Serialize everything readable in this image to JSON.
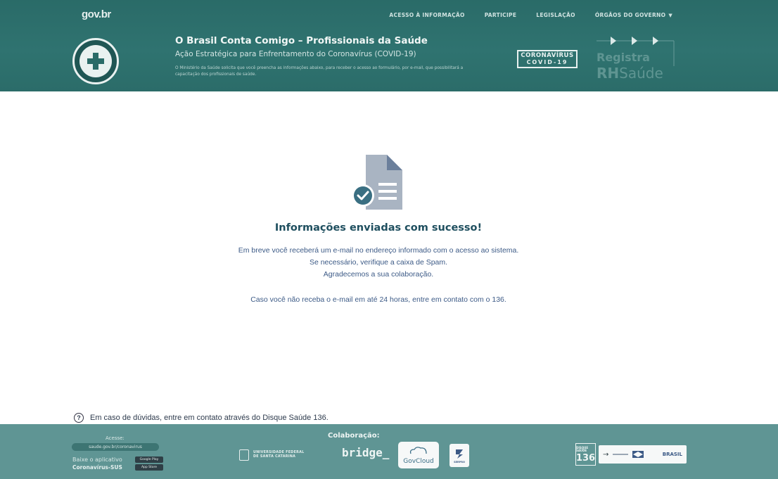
{
  "header": {
    "govbr_logo": "gov.br",
    "nav": [
      {
        "label": "ACESSO À INFORMAÇÃO"
      },
      {
        "label": "PARTICIPE"
      },
      {
        "label": "LEGISLAÇÃO"
      },
      {
        "label": "ÓRGÃOS DO GOVERNO",
        "chevron": "▼"
      }
    ],
    "title": "O Brasil Conta Comigo – Profissionais da Saúde",
    "subtitle": "Ação Estratégica para Enfrentamento do Coronavírus (COVID-19)",
    "description": "O Ministério da Saúde solicita que você preencha as informações abaixo, para receber o acesso ao formulário, por e-mail, que possibilitará a capacitação dos profissionais de saúde.",
    "covid_badge": {
      "line1": "CORONAVÍRUS",
      "line2": "COVID-19"
    },
    "registra": {
      "line1": "Registra",
      "line2_bold": "RH",
      "line2": "Saúde"
    }
  },
  "main": {
    "icon": "document-check-icon",
    "success_title": "Informações enviadas com sucesso!",
    "message_lines": [
      "Em breve você receberá um e-mail no endereço informado com o acesso ao sistema.",
      "Se necessário, verifique a caixa de Spam.",
      "Agradecemos a sua colaboração."
    ],
    "contact_line": "Caso você não receba o e-mail em até 24 horas, entre em contato com o 136.",
    "help_text": "Em caso de dúvidas, entre em contato através do Disque Saúde 136."
  },
  "footer": {
    "acesse": "Acesse:",
    "acesse_link": "saude.gov.br/coronavirus",
    "baixe": "Baixe o aplicativo",
    "app_name": "Coronavírus-SUS",
    "google_play": "Google Play",
    "app_store": "App Store",
    "colaboracao": "Colaboração:",
    "ufsc": {
      "line1": "UNIVERSIDADE FEDERAL",
      "line2": "DE SANTA CATARINA"
    },
    "bridge": "bridge_",
    "govcloud": "GovCloud",
    "serpro": "SERPRO",
    "disque": {
      "line1": "DISQUE SAÚDE",
      "line2": "136"
    },
    "brasil": "BRASIL"
  },
  "colors": {
    "header_bg": "#2f7370",
    "footer_bg": "#5f9594",
    "title_text": "#1f4f5f",
    "message_text": "#3c5a86",
    "check_circle": "#3a6f82",
    "doc_gray": "#a9b4c2"
  }
}
